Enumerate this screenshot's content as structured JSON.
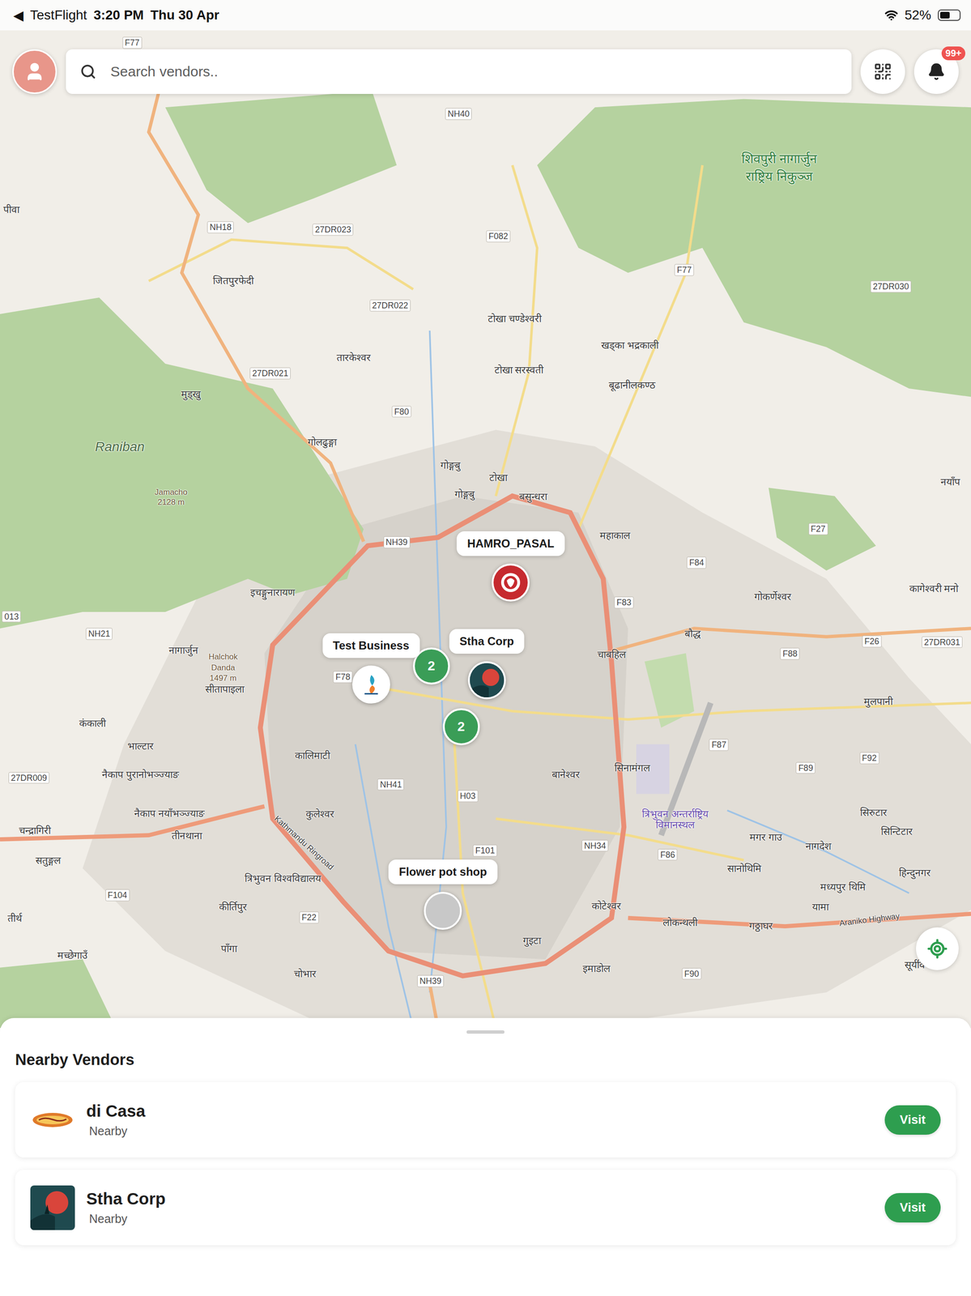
{
  "status_bar": {
    "back_icon": "◀",
    "app": "TestFlight",
    "time": "3:20 PM",
    "date": "Thu 30 Apr",
    "battery": "52%",
    "battery_level": 0.52
  },
  "search": {
    "placeholder": "Search vendors.."
  },
  "notifications": {
    "badge": "99+"
  },
  "map": {
    "labels": [
      {
        "text": "F77",
        "kind": "road"
      },
      {
        "text": "NH40",
        "kind": "road"
      },
      {
        "text": "शिवपुरी नागार्जुन",
        "kind": "park"
      },
      {
        "text": "राष्ट्रिय निकुञ्ज",
        "kind": "park"
      },
      {
        "text": "पीवा",
        "kind": "place"
      },
      {
        "text": "NH18",
        "kind": "road"
      },
      {
        "text": "27DR023",
        "kind": "road"
      },
      {
        "text": "F082",
        "kind": "road"
      },
      {
        "text": "F77",
        "kind": "road"
      },
      {
        "text": "जितपुरफेदी",
        "kind": "place"
      },
      {
        "text": "27DR030",
        "kind": "road"
      },
      {
        "text": "27DR022",
        "kind": "road"
      },
      {
        "text": "टोखा चण्डेश्वरी",
        "kind": "place"
      },
      {
        "text": "खड्का भद्रकाली",
        "kind": "place"
      },
      {
        "text": "तारकेश्वर",
        "kind": "place"
      },
      {
        "text": "टोखा सरस्वती",
        "kind": "place"
      },
      {
        "text": "27DR021",
        "kind": "road"
      },
      {
        "text": "बूढानीलकण्ठ",
        "kind": "place"
      },
      {
        "text": "मुड्खु",
        "kind": "place"
      },
      {
        "text": "F80",
        "kind": "road"
      },
      {
        "text": "गोलढुङ्गा",
        "kind": "place"
      },
      {
        "text": "Raniban",
        "kind": "area"
      },
      {
        "text": "गोङ्गबु",
        "kind": "place"
      },
      {
        "text": "टोखा",
        "kind": "place"
      },
      {
        "text": "नयाँप",
        "kind": "place"
      },
      {
        "text": "Jamacho",
        "kind": "peak"
      },
      {
        "text": "2128 m",
        "kind": "peak"
      },
      {
        "text": "गोङ्गबु",
        "kind": "place"
      },
      {
        "text": "बसुन्धरा",
        "kind": "place"
      },
      {
        "text": "F27",
        "kind": "road"
      },
      {
        "text": "महाकाल",
        "kind": "place"
      },
      {
        "text": "NH39",
        "kind": "road"
      },
      {
        "text": "F84",
        "kind": "road"
      },
      {
        "text": "कागेश्वरी मनो",
        "kind": "place"
      },
      {
        "text": "इचङ्गुनारायण",
        "kind": "place"
      },
      {
        "text": "गोकर्णेश्वर",
        "kind": "place"
      },
      {
        "text": "F83",
        "kind": "road"
      },
      {
        "text": "NH21",
        "kind": "road"
      },
      {
        "text": "बौद्ध",
        "kind": "place"
      },
      {
        "text": "F26",
        "kind": "road"
      },
      {
        "text": "27DR031",
        "kind": "road"
      },
      {
        "text": "नागार्जुन",
        "kind": "place"
      },
      {
        "text": "चाबहिल",
        "kind": "place"
      },
      {
        "text": "F88",
        "kind": "road"
      },
      {
        "text": "Halchok",
        "kind": "peak"
      },
      {
        "text": "Danda",
        "kind": "peak"
      },
      {
        "text": "1497 m",
        "kind": "peak"
      },
      {
        "text": "सीतापाइला",
        "kind": "place"
      },
      {
        "text": "F78",
        "kind": "road"
      },
      {
        "text": "मुलपानी",
        "kind": "place"
      },
      {
        "text": "कंकाली",
        "kind": "place"
      },
      {
        "text": "भाल्टार",
        "kind": "place"
      },
      {
        "text": "F87",
        "kind": "road"
      },
      {
        "text": "कालिमाटी",
        "kind": "place"
      },
      {
        "text": "सिनामंगल",
        "kind": "place"
      },
      {
        "text": "F89",
        "kind": "road"
      },
      {
        "text": "F92",
        "kind": "road"
      },
      {
        "text": "नैकाप पुरानोभञ्ज्याङ",
        "kind": "place"
      },
      {
        "text": "बानेश्वर",
        "kind": "place"
      },
      {
        "text": "27DR009",
        "kind": "road"
      },
      {
        "text": "NH41",
        "kind": "road"
      },
      {
        "text": "H03",
        "kind": "road"
      },
      {
        "text": "त्रिभुवन अन्तर्राष्ट्रिय",
        "kind": "airport"
      },
      {
        "text": "विमानस्थल",
        "kind": "airport"
      },
      {
        "text": "सिरुटार",
        "kind": "place"
      },
      {
        "text": "नैकाप नयाँभञ्ज्याङ",
        "kind": "place"
      },
      {
        "text": "कुलेश्वर",
        "kind": "place"
      },
      {
        "text": "चन्द्रागिरी",
        "kind": "place"
      },
      {
        "text": "सिन्टिटार",
        "kind": "place"
      },
      {
        "text": "तीनथाना",
        "kind": "place"
      },
      {
        "text": "मगर गाउ",
        "kind": "place"
      },
      {
        "text": "NH34",
        "kind": "road"
      },
      {
        "text": "नागदेश",
        "kind": "place"
      },
      {
        "text": "F101",
        "kind": "road"
      },
      {
        "text": "F86",
        "kind": "road"
      },
      {
        "text": "सतुङ्गल",
        "kind": "place"
      },
      {
        "text": "सानोथिमि",
        "kind": "place"
      },
      {
        "text": "हिन्दुनगर",
        "kind": "place"
      },
      {
        "text": "त्रिभुवन विश्वविद्यालय",
        "kind": "place"
      },
      {
        "text": "मध्यपुर थिमि",
        "kind": "place"
      },
      {
        "text": "F104",
        "kind": "road"
      },
      {
        "text": "कीर्तिपुर",
        "kind": "place"
      },
      {
        "text": "कोटेश्वर",
        "kind": "place"
      },
      {
        "text": "यामा",
        "kind": "place"
      },
      {
        "text": "तीर्थ",
        "kind": "place"
      },
      {
        "text": "F22",
        "kind": "road"
      },
      {
        "text": "लोकन्थली",
        "kind": "place"
      },
      {
        "text": "गठ्ठाघर",
        "kind": "place"
      },
      {
        "text": "गुइटा",
        "kind": "place"
      },
      {
        "text": "पाँगा",
        "kind": "place"
      },
      {
        "text": "मच्छेगाउँ",
        "kind": "place"
      },
      {
        "text": "सूर्यविनायक",
        "kind": "place"
      },
      {
        "text": "इमाडोल",
        "kind": "place"
      },
      {
        "text": "F90",
        "kind": "road"
      },
      {
        "text": "चोभार",
        "kind": "place"
      },
      {
        "text": "NH39",
        "kind": "road"
      },
      {
        "text": "Kathmandu Ringroad",
        "kind": "roadname"
      },
      {
        "text": "Araniko Highway",
        "kind": "roadname"
      },
      {
        "text": "013",
        "kind": "road"
      }
    ],
    "pins": [
      {
        "name": "HAMRO_PASAL",
        "color": "#c62a2f"
      },
      {
        "name": "Test Business",
        "color": "#ffffff"
      },
      {
        "name": "Stha Corp",
        "color": "#1f4a4f"
      },
      {
        "name": "Flower pot shop",
        "color": "#c8c8c8"
      }
    ],
    "clusters": [
      {
        "count": "2"
      },
      {
        "count": "2"
      }
    ]
  },
  "sheet": {
    "title": "Nearby Vendors",
    "vendors": [
      {
        "name": "di Casa",
        "subtitle": "Nearby",
        "button": "Visit",
        "color": "#e07a2a"
      },
      {
        "name": "Stha Corp",
        "subtitle": "Nearby",
        "button": "Visit",
        "color": "#1f4a4f"
      }
    ]
  }
}
